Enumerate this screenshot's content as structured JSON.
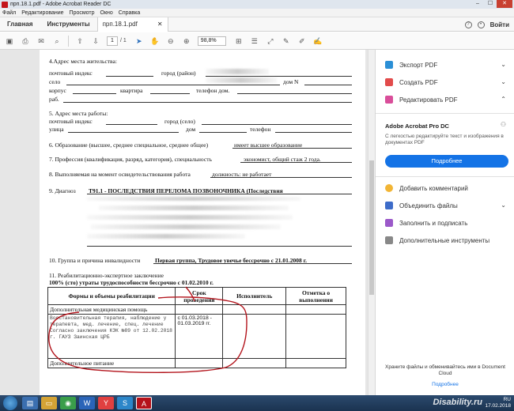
{
  "window": {
    "title": "прп.18.1.pdf - Adobe Acrobat Reader DC"
  },
  "menu": [
    "Файл",
    "Редактирование",
    "Просмотр",
    "Окно",
    "Справка"
  ],
  "tabs": {
    "home": "Главная",
    "tools": "Инструменты",
    "document": "прп.18.1.pdf",
    "login": "Войти"
  },
  "toolbar": {
    "page_current": "1",
    "page_total": "/ 1",
    "zoom": "98,8%"
  },
  "document": {
    "s4_title": "4.Адрес места жительства:",
    "s4_l1a": "почтовый индекс",
    "s4_l1b": "город (район)",
    "s4_l2a": "село",
    "s4_l2b": "дом N",
    "s4_l3a": "корпус",
    "s4_l3b": "квартира",
    "s4_l3c": "телефон дом.",
    "s4_l4a": "раб.",
    "s5_title": "5. Адрес места работы:",
    "s5_l1a": "почтовый индекс",
    "s5_l1b": "город (село)",
    "s5_l2a": "улица",
    "s5_l2b": "дом",
    "s5_l2c": "телефон",
    "s6_label": "6. Образование (высшее, среднее специальное, среднее общее)",
    "s6_value": "имеет высшее образование",
    "s7_label": "7. Профессия (квалификация, разряд, категория), специальность",
    "s7_value": "экономист, общий стаж 2 года.",
    "s8_label": "8. Выполняемая на момент освидетельствования работа",
    "s8_value": "должность: не работает",
    "s9_label": "9. Диагноз",
    "s9_value": "T91.1 - ПОСЛЕДСТВИЯ ПЕРЕЛОМА ПОЗВОНОЧНИКА (Последствия",
    "s10_label": "10. Группа и причина инвалидности",
    "s10_value": "Первая группа, Трудовое увечье бессрочно с 21.01.2008 г.",
    "s11_title": "11. Реабилитационно-экспертное заключение",
    "s11_value": "100% (сто) утраты трудоспособности бессрочно с 01.02.2010 г.",
    "table": {
      "h1": "Формы и объемы реабилитации",
      "h2": "Срок проведения",
      "h3": "Исполнитель",
      "h4": "Отметка о выполнении",
      "r1": "Дополнительная медицинская помощь",
      "r2_text": "Восстановительная терапия, наблюдение у терапевта, мед. лечение, спец. лечение Согласно заключения КЭК №89 от 12.02.2018 г. ГАУЗ Заинская ЦРБ",
      "r2_term": "с 01.03.2018 - 01.03.2019 гг.",
      "r3": "Дополнительное питание"
    }
  },
  "panel": {
    "export": "Экспорт PDF",
    "create": "Создать PDF",
    "edit": "Редактировать PDF",
    "pro_title": "Adobe Acrobat Pro DC",
    "pro_desc": "С легкостью редактируйте текст и изображения в документах PDF",
    "more_btn": "Подробнее",
    "comment": "Добавить комментарий",
    "combine": "Объединить файлы",
    "fill": "Заполнить и подписать",
    "more_tools": "Дополнительные инструменты",
    "cloud_text": "Храните файлы и обменивайтесь ими в Document Cloud",
    "cloud_link": "Подробнее"
  },
  "taskbar": {
    "watermark": "Disability.ru",
    "lang": "RU",
    "date": "17.02.2018"
  }
}
